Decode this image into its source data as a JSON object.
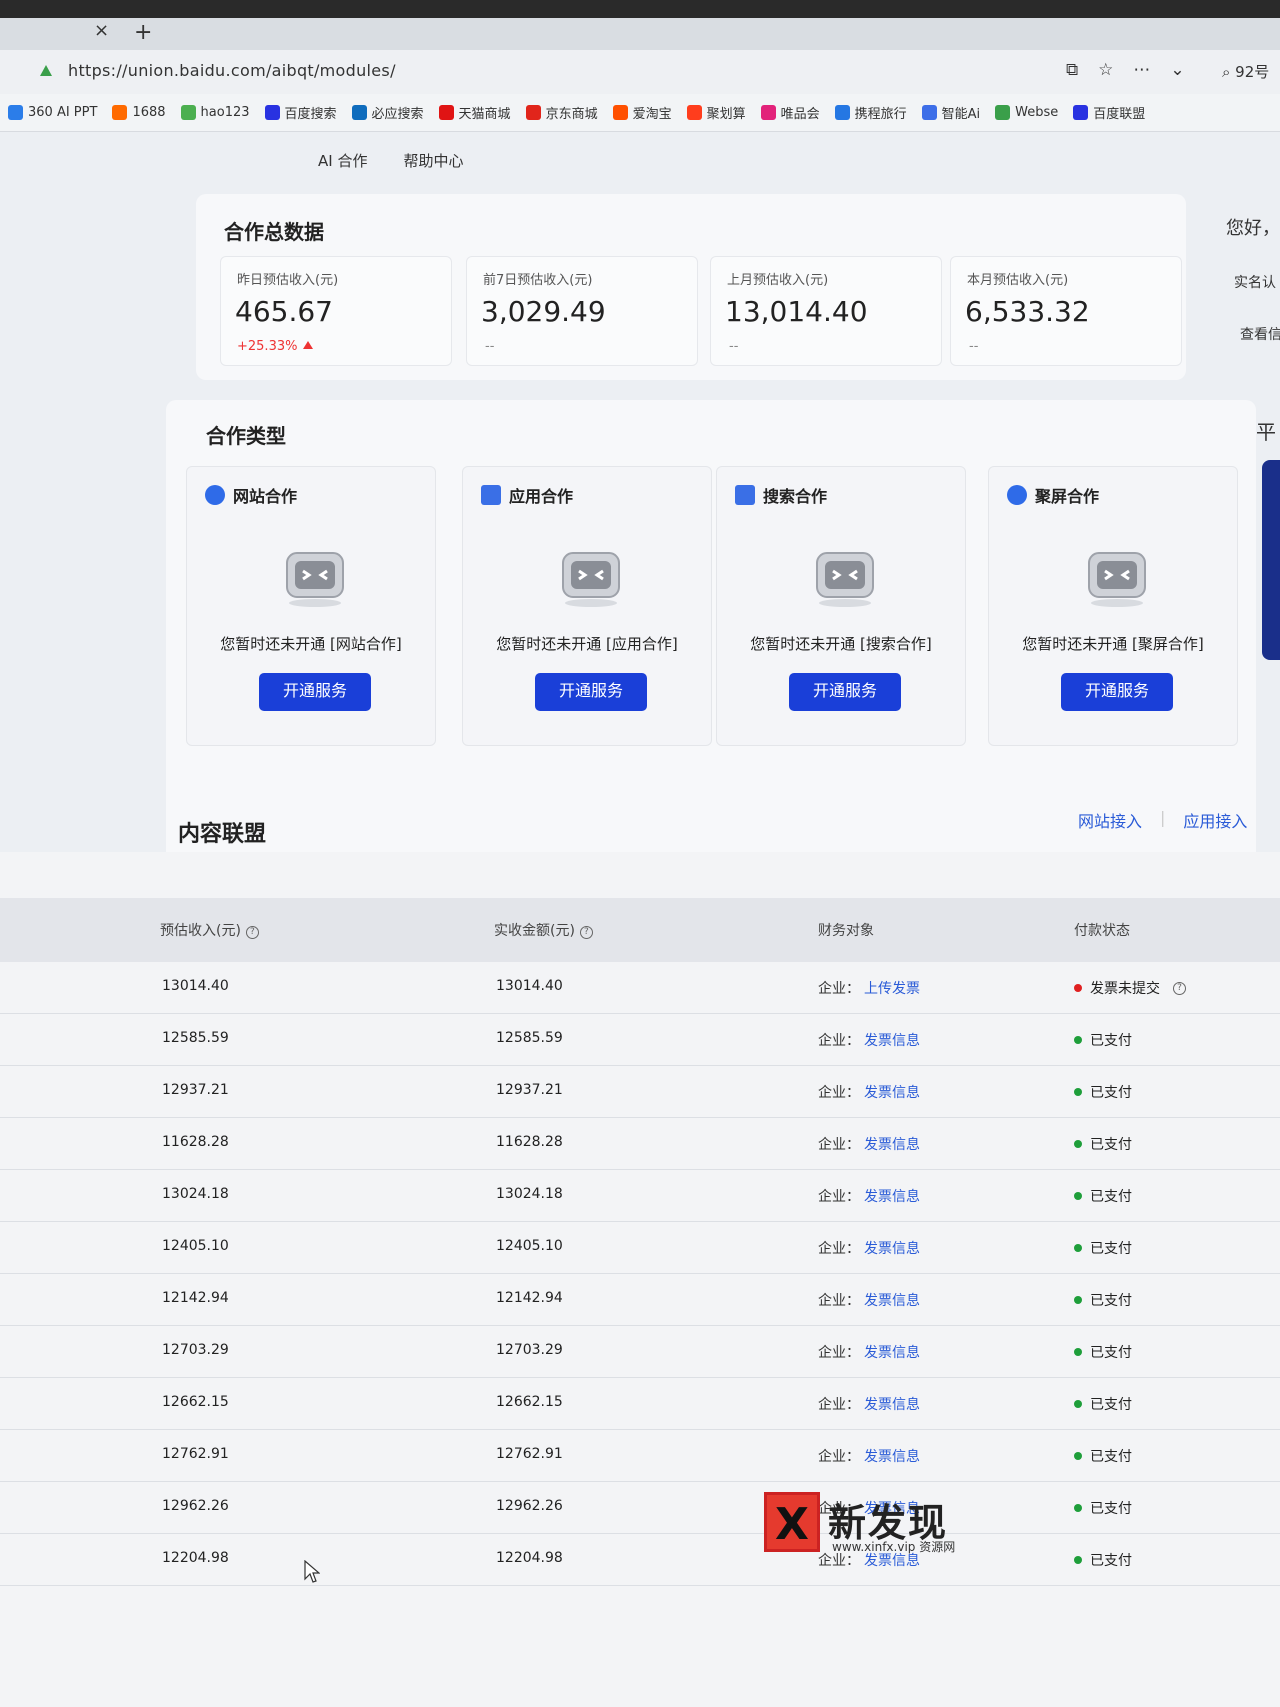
{
  "browser": {
    "tab_close": "×",
    "tab_new": "+",
    "url": "https://union.baidu.com/aibqt/modules/",
    "search_text": "92号",
    "bookmarks": [
      {
        "label": "360 AI PPT",
        "color": "#2b7de9"
      },
      {
        "label": "1688",
        "color": "#ff6a00"
      },
      {
        "label": "hao123",
        "color": "#4caf50"
      },
      {
        "label": "百度搜索",
        "color": "#2932e1"
      },
      {
        "label": "必应搜索",
        "color": "#0f6cbd"
      },
      {
        "label": "天猫商城",
        "color": "#e01414"
      },
      {
        "label": "京东商城",
        "color": "#e1251b"
      },
      {
        "label": "爱淘宝",
        "color": "#ff5000"
      },
      {
        "label": "聚划算",
        "color": "#ff3d1d"
      },
      {
        "label": "唯品会",
        "color": "#e2227a"
      },
      {
        "label": "携程旅行",
        "color": "#2577e3"
      },
      {
        "label": "智能Ai",
        "color": "#3d6ee8"
      },
      {
        "label": "Webse",
        "color": "#3a9f4a"
      },
      {
        "label": "百度联盟",
        "color": "#2932e1"
      }
    ]
  },
  "nav": {
    "ai": "AI 合作",
    "help": "帮助中心"
  },
  "summary": {
    "title": "合作总数据",
    "stats": [
      {
        "label": "昨日预估收入(元)",
        "value": "465.67",
        "change": "+25.33%"
      },
      {
        "label": "前7日预估收入(元)",
        "value": "3,029.49",
        "change": "--"
      },
      {
        "label": "上月预估收入(元)",
        "value": "13,014.40",
        "change": "--"
      },
      {
        "label": "本月预估收入(元)",
        "value": "6,533.32",
        "change": "--"
      }
    ]
  },
  "coop": {
    "title": "合作类型",
    "button": "开通服务",
    "items": [
      {
        "name": "网站合作",
        "msg": "您暂时还未开通 [网站合作]"
      },
      {
        "name": "应用合作",
        "msg": "您暂时还未开通 [应用合作]"
      },
      {
        "name": "搜索合作",
        "msg": "您暂时还未开通 [搜索合作]"
      },
      {
        "name": "聚屏合作",
        "msg": "您暂时还未开通 [聚屏合作]"
      }
    ]
  },
  "side": {
    "greet": "您好，",
    "l1": "实名认",
    "l2": "查看信",
    "l3": "平"
  },
  "content_union": {
    "title": "内容联盟",
    "link1": "网站接入",
    "link2": "应用接入"
  },
  "table": {
    "headers": {
      "est": "预估收入(元)",
      "act": "实收金额(元)",
      "fin": "财务对象",
      "pay": "付款状态"
    },
    "ent_label": "企业：",
    "rows": [
      {
        "est": "13014.40",
        "act": "13014.40",
        "link": "上传发票",
        "status": "发票未提交",
        "status_color": "#e02020",
        "help": true
      },
      {
        "est": "12585.59",
        "act": "12585.59",
        "link": "发票信息",
        "status": "已支付",
        "status_color": "#1e9e3a"
      },
      {
        "est": "12937.21",
        "act": "12937.21",
        "link": "发票信息",
        "status": "已支付",
        "status_color": "#1e9e3a"
      },
      {
        "est": "11628.28",
        "act": "11628.28",
        "link": "发票信息",
        "status": "已支付",
        "status_color": "#1e9e3a"
      },
      {
        "est": "13024.18",
        "act": "13024.18",
        "link": "发票信息",
        "status": "已支付",
        "status_color": "#1e9e3a"
      },
      {
        "est": "12405.10",
        "act": "12405.10",
        "link": "发票信息",
        "status": "已支付",
        "status_color": "#1e9e3a"
      },
      {
        "est": "12142.94",
        "act": "12142.94",
        "link": "发票信息",
        "status": "已支付",
        "status_color": "#1e9e3a"
      },
      {
        "est": "12703.29",
        "act": "12703.29",
        "link": "发票信息",
        "status": "已支付",
        "status_color": "#1e9e3a"
      },
      {
        "est": "12662.15",
        "act": "12662.15",
        "link": "发票信息",
        "status": "已支付",
        "status_color": "#1e9e3a"
      },
      {
        "est": "12762.91",
        "act": "12762.91",
        "link": "发票信息",
        "status": "已支付",
        "status_color": "#1e9e3a"
      },
      {
        "est": "12962.26",
        "act": "12962.26",
        "link": "发票信息",
        "status": "已支付",
        "status_color": "#1e9e3a"
      },
      {
        "est": "12204.98",
        "act": "12204.98",
        "link": "发票信息",
        "status": "已支付",
        "status_color": "#1e9e3a"
      }
    ]
  },
  "watermark": {
    "x": "X",
    "big": "新发现",
    "small": "www.xinfx.vip 资源网"
  },
  "colors": {
    "accent": "#1a3fd8",
    "link": "#2a5bd7",
    "up": "#e33333"
  }
}
